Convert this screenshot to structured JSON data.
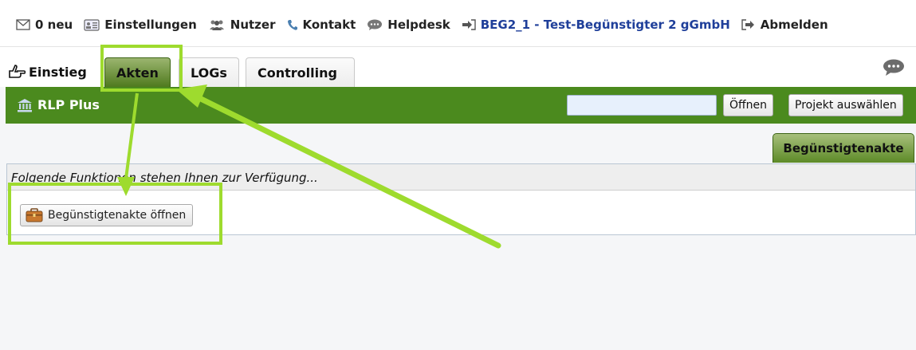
{
  "topnav": {
    "messages": "0 neu",
    "settings": "Einstellungen",
    "users": "Nutzer",
    "contact": "Kontakt",
    "helpdesk": "Helpdesk",
    "current_user": "BEG2_1 - Test-Begünstigter 2 gGmbH",
    "logout": "Abmelden"
  },
  "tabs": [
    {
      "label": "Einstieg",
      "icon": "pointing-hand-icon"
    },
    {
      "label": "Akten",
      "active": true
    },
    {
      "label": "LOGs"
    },
    {
      "label": "Controlling"
    }
  ],
  "bar": {
    "title": "RLP Plus",
    "title_icon": "bank-icon",
    "search_value": "",
    "open_button": "Öffnen",
    "select_project_button": "Projekt auswählen"
  },
  "subtab": {
    "label": "Begünstigtenakte"
  },
  "panel": {
    "heading": "Folgende Funktionen stehen Ihnen zur Verfügung...",
    "open_file_button": "Begünstigtenakte öffnen",
    "open_file_icon": "briefcase-icon"
  },
  "colors": {
    "green_bar": "#4b8a1e",
    "active_tab": "#6f9337",
    "annotation": "#9edb2e",
    "user_link": "#1f3f9a"
  }
}
